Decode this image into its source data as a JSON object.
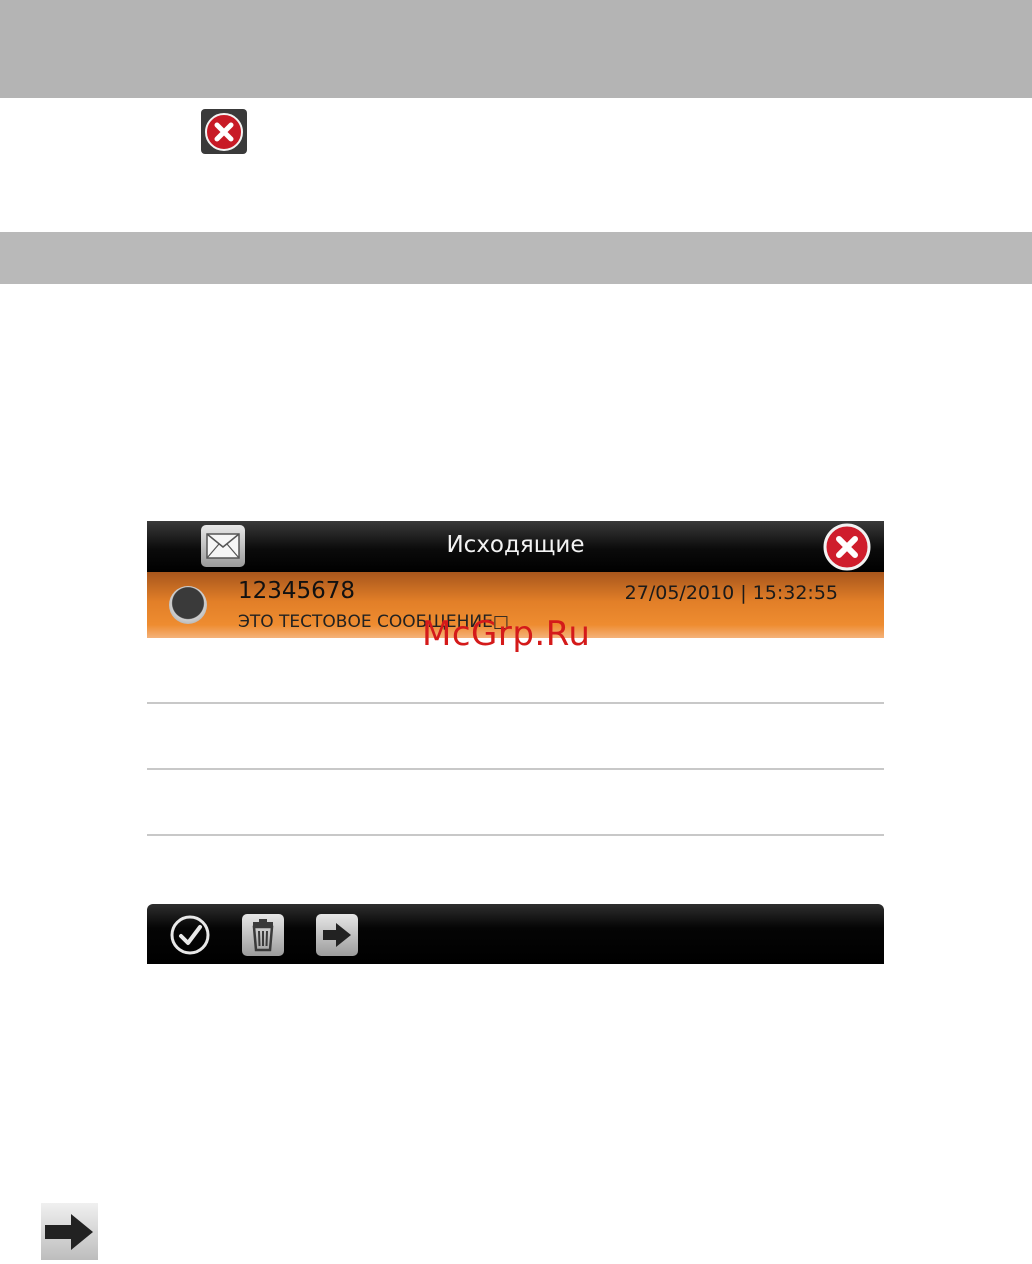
{
  "screen": {
    "title": "Исходящие",
    "icons": {
      "mail": "envelope-icon",
      "close": "close-icon",
      "check": "check-icon",
      "delete": "trash-icon",
      "forward": "arrow-right-icon"
    },
    "message": {
      "number": "12345678",
      "datetime": "27/05/2010 | 15:32:55",
      "text": "ЭТО ТЕСТОВОЕ СООБЩЕНИЕ□"
    }
  },
  "watermark": "McGrp.Ru",
  "colors": {
    "accent_orange": "#e8822c",
    "bar_black": "#000000",
    "close_red": "#c8102e"
  }
}
